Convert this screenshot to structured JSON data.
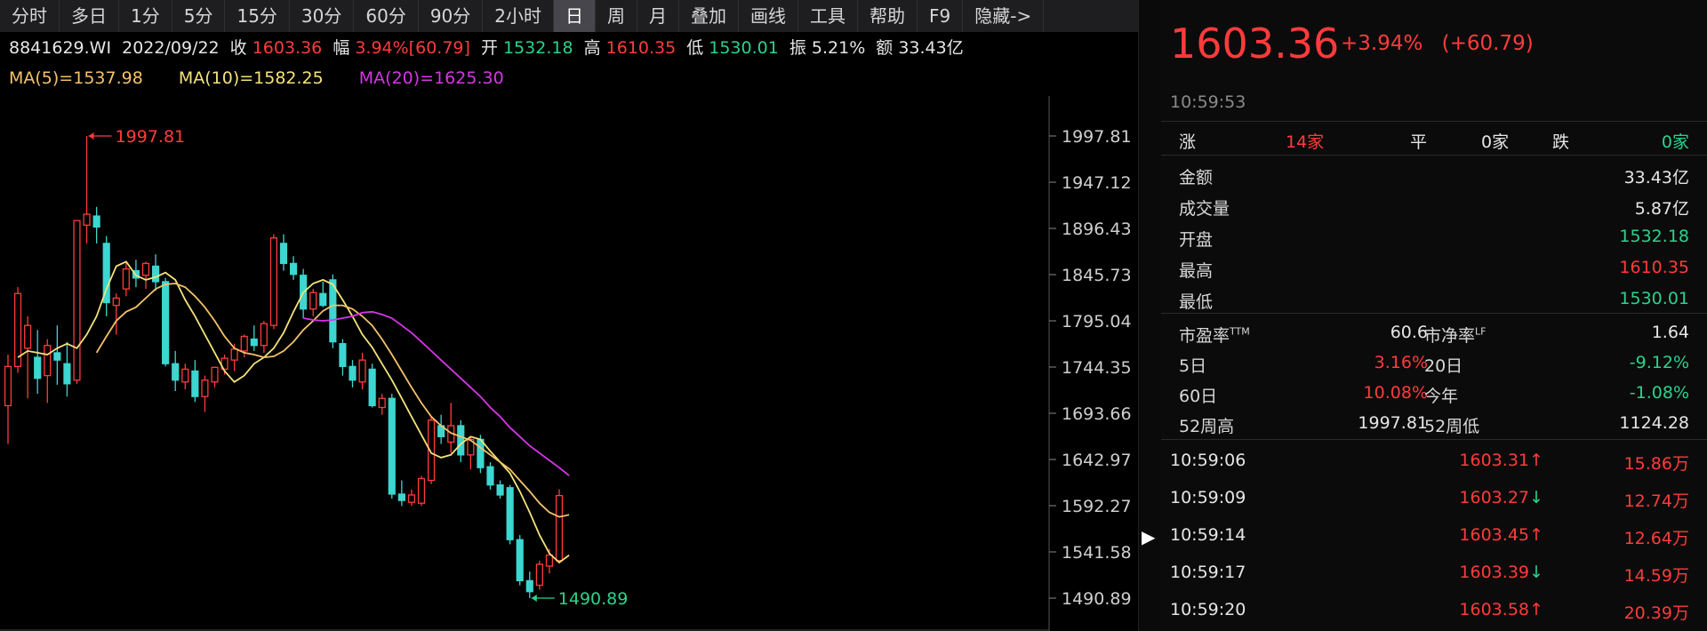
{
  "toolbar": {
    "tabs": [
      "分时",
      "多日",
      "1分",
      "5分",
      "15分",
      "30分",
      "60分",
      "90分",
      "2小时",
      "日",
      "周",
      "月",
      "叠加",
      "画线",
      "工具",
      "帮助",
      "F9",
      "隐藏->"
    ],
    "active": "日"
  },
  "info_line": {
    "code": "8841629.WI",
    "date": "2022/09/22",
    "close_label": "收",
    "close": "1603.36",
    "amp_label": "幅",
    "amp": "3.94%[60.79]",
    "open_label": "开",
    "open": "1532.18",
    "high_label": "高",
    "high": "1610.35",
    "low_label": "低",
    "low": "1530.01",
    "swing_label": "振",
    "swing": "5.21%",
    "amount_label": "额",
    "amount": "33.43亿"
  },
  "ma_line": {
    "ma5": "MA(5)=1537.98",
    "ma10": "MA(10)=1582.25",
    "ma20": "MA(20)=1625.30"
  },
  "colors": {
    "up": "#ff3b3b",
    "down": "#3dd6d0",
    "ma5": "#f3e37a",
    "ma10": "#f3c26b",
    "ma20": "#d636e6",
    "axis": "#cfcfcf"
  },
  "chart_data": {
    "type": "candlestick",
    "y_ticks": [
      "1997.81",
      "1947.12",
      "1896.43",
      "1845.73",
      "1795.04",
      "1744.35",
      "1693.66",
      "1642.97",
      "1592.27",
      "1541.58",
      "1490.89"
    ],
    "ylim": [
      1490.89,
      1997.81
    ],
    "annotations": [
      {
        "text": "1997.81",
        "value": 1997.81,
        "type": "high"
      },
      {
        "text": "1490.89",
        "value": 1490.89,
        "type": "low"
      }
    ],
    "candles": [
      {
        "o": 1702,
        "h": 1758,
        "l": 1660,
        "c": 1745
      },
      {
        "o": 1745,
        "h": 1832,
        "l": 1738,
        "c": 1825
      },
      {
        "o": 1765,
        "h": 1800,
        "l": 1710,
        "c": 1790
      },
      {
        "o": 1755,
        "h": 1785,
        "l": 1715,
        "c": 1732
      },
      {
        "o": 1735,
        "h": 1775,
        "l": 1705,
        "c": 1768
      },
      {
        "o": 1760,
        "h": 1790,
        "l": 1725,
        "c": 1752
      },
      {
        "o": 1748,
        "h": 1772,
        "l": 1712,
        "c": 1726
      },
      {
        "o": 1730,
        "h": 1900,
        "l": 1726,
        "c": 1905
      },
      {
        "o": 1900,
        "h": 1997.81,
        "l": 1880,
        "c": 1912
      },
      {
        "o": 1910,
        "h": 1920,
        "l": 1880,
        "c": 1898
      },
      {
        "o": 1880,
        "h": 1888,
        "l": 1800,
        "c": 1815
      },
      {
        "o": 1812,
        "h": 1825,
        "l": 1780,
        "c": 1820
      },
      {
        "o": 1830,
        "h": 1860,
        "l": 1822,
        "c": 1852
      },
      {
        "o": 1850,
        "h": 1862,
        "l": 1832,
        "c": 1842
      },
      {
        "o": 1845,
        "h": 1860,
        "l": 1830,
        "c": 1858
      },
      {
        "o": 1855,
        "h": 1868,
        "l": 1828,
        "c": 1838
      },
      {
        "o": 1838,
        "h": 1842,
        "l": 1745,
        "c": 1748
      },
      {
        "o": 1748,
        "h": 1762,
        "l": 1718,
        "c": 1730
      },
      {
        "o": 1728,
        "h": 1748,
        "l": 1720,
        "c": 1742
      },
      {
        "o": 1740,
        "h": 1752,
        "l": 1706,
        "c": 1712
      },
      {
        "o": 1712,
        "h": 1735,
        "l": 1695,
        "c": 1730
      },
      {
        "o": 1728,
        "h": 1745,
        "l": 1722,
        "c": 1744
      },
      {
        "o": 1742,
        "h": 1758,
        "l": 1736,
        "c": 1754
      },
      {
        "o": 1752,
        "h": 1770,
        "l": 1740,
        "c": 1764
      },
      {
        "o": 1762,
        "h": 1780,
        "l": 1755,
        "c": 1778
      },
      {
        "o": 1775,
        "h": 1790,
        "l": 1762,
        "c": 1768
      },
      {
        "o": 1768,
        "h": 1795,
        "l": 1760,
        "c": 1792
      },
      {
        "o": 1790,
        "h": 1890,
        "l": 1786,
        "c": 1886
      },
      {
        "o": 1880,
        "h": 1890,
        "l": 1850,
        "c": 1858
      },
      {
        "o": 1858,
        "h": 1866,
        "l": 1840,
        "c": 1846
      },
      {
        "o": 1845,
        "h": 1852,
        "l": 1798,
        "c": 1808
      },
      {
        "o": 1808,
        "h": 1830,
        "l": 1800,
        "c": 1826
      },
      {
        "o": 1825,
        "h": 1838,
        "l": 1810,
        "c": 1812
      },
      {
        "o": 1840,
        "h": 1846,
        "l": 1765,
        "c": 1772
      },
      {
        "o": 1770,
        "h": 1775,
        "l": 1735,
        "c": 1745
      },
      {
        "o": 1745,
        "h": 1752,
        "l": 1722,
        "c": 1730
      },
      {
        "o": 1728,
        "h": 1760,
        "l": 1720,
        "c": 1752
      },
      {
        "o": 1742,
        "h": 1748,
        "l": 1700,
        "c": 1702
      },
      {
        "o": 1700,
        "h": 1715,
        "l": 1692,
        "c": 1710
      },
      {
        "o": 1710,
        "h": 1715,
        "l": 1600,
        "c": 1605
      },
      {
        "o": 1605,
        "h": 1620,
        "l": 1592,
        "c": 1598
      },
      {
        "o": 1596,
        "h": 1610,
        "l": 1592,
        "c": 1604
      },
      {
        "o": 1595,
        "h": 1625,
        "l": 1592,
        "c": 1622
      },
      {
        "o": 1620,
        "h": 1690,
        "l": 1616,
        "c": 1686
      },
      {
        "o": 1680,
        "h": 1692,
        "l": 1660,
        "c": 1668
      },
      {
        "o": 1662,
        "h": 1705,
        "l": 1650,
        "c": 1680
      },
      {
        "o": 1680,
        "h": 1686,
        "l": 1640,
        "c": 1648
      },
      {
        "o": 1648,
        "h": 1668,
        "l": 1632,
        "c": 1665
      },
      {
        "o": 1665,
        "h": 1670,
        "l": 1628,
        "c": 1634
      },
      {
        "o": 1635,
        "h": 1640,
        "l": 1610,
        "c": 1615
      },
      {
        "o": 1615,
        "h": 1620,
        "l": 1600,
        "c": 1604
      },
      {
        "o": 1612,
        "h": 1615,
        "l": 1550,
        "c": 1555
      },
      {
        "o": 1555,
        "h": 1560,
        "l": 1505,
        "c": 1510
      },
      {
        "o": 1510,
        "h": 1520,
        "l": 1490.89,
        "c": 1498
      },
      {
        "o": 1505,
        "h": 1532,
        "l": 1500,
        "c": 1528
      },
      {
        "o": 1526,
        "h": 1545,
        "l": 1518,
        "c": 1538
      },
      {
        "o": 1532.18,
        "h": 1610.35,
        "l": 1530.01,
        "c": 1603.36
      }
    ],
    "ma5_values": [
      1755,
      1762,
      1760,
      1758,
      1765,
      1770,
      1765,
      1780,
      1800,
      1830,
      1855,
      1860,
      1845,
      1840,
      1843,
      1848,
      1840,
      1818,
      1800,
      1780,
      1760,
      1740,
      1728,
      1735,
      1748,
      1755,
      1765,
      1782,
      1805,
      1826,
      1836,
      1840,
      1835,
      1818,
      1800,
      1780,
      1766,
      1748,
      1730,
      1710,
      1690,
      1670,
      1650,
      1645,
      1648,
      1660,
      1668,
      1665,
      1652,
      1640,
      1628,
      1608,
      1585,
      1560,
      1540,
      1530,
      1537.98
    ],
    "ma10_values": [
      null,
      null,
      null,
      null,
      null,
      null,
      null,
      null,
      1760,
      1778,
      1795,
      1805,
      1810,
      1820,
      1830,
      1835,
      1836,
      1832,
      1822,
      1810,
      1795,
      1778,
      1765,
      1760,
      1758,
      1755,
      1756,
      1762,
      1772,
      1785,
      1795,
      1806,
      1812,
      1812,
      1808,
      1800,
      1790,
      1775,
      1758,
      1740,
      1722,
      1705,
      1690,
      1680,
      1672,
      1668,
      1664,
      1656,
      1648,
      1640,
      1632,
      1620,
      1608,
      1595,
      1585,
      1580,
      1582.25
    ],
    "ma20_values": [
      null,
      null,
      null,
      null,
      null,
      null,
      null,
      null,
      null,
      null,
      null,
      null,
      null,
      null,
      null,
      null,
      null,
      null,
      null,
      null,
      null,
      null,
      1798,
      1796,
      1795,
      1796,
      1798,
      1800,
      1804,
      1805,
      1802,
      1798,
      1790,
      1782,
      1772,
      1762,
      1752,
      1742,
      1732,
      1722,
      1712,
      1700,
      1690,
      1678,
      1668,
      1658,
      1650,
      1642,
      1634,
      1625.3
    ]
  },
  "right_panel": {
    "price": "1603.36",
    "change_pct": "+3.94%",
    "change_val": "(+60.79)",
    "time": "10:59:53",
    "breadth": {
      "up_label": "涨",
      "up_count": "14家",
      "flat_label": "平",
      "flat_count": "0家",
      "down_label": "跌",
      "down_count": "0家"
    },
    "stats": [
      {
        "k": "金额",
        "v": "33.43亿",
        "color": "white"
      },
      {
        "k": "成交量",
        "v": "5.87亿",
        "color": "white"
      },
      {
        "k": "开盘",
        "v": "1532.18",
        "color": "green"
      },
      {
        "k": "最高",
        "v": "1610.35",
        "color": "red"
      },
      {
        "k": "最低",
        "v": "1530.01",
        "color": "green"
      }
    ],
    "ratios": {
      "pe_label": "市盈率",
      "pe_sup": "TTM",
      "pe": "60.6",
      "pb_label": "市净率",
      "pb_sup": "LF",
      "pb": "1.64",
      "r5_label": "5日",
      "r5": "3.16%",
      "r20_label": "20日",
      "r20": "-9.12%",
      "r60_label": "60日",
      "r60": "10.08%",
      "ytd_label": "今年",
      "ytd": "-1.08%",
      "h52_label": "52周高",
      "h52": "1997.81",
      "l52_label": "52周低",
      "l52": "1124.28"
    },
    "ticks": [
      {
        "time": "10:59:06",
        "price": "1603.31",
        "dir": "up",
        "vol": "15.86万"
      },
      {
        "time": "10:59:09",
        "price": "1603.27",
        "dir": "down",
        "vol": "12.74万"
      },
      {
        "time": "10:59:14",
        "price": "1603.45",
        "dir": "up",
        "vol": "12.64万"
      },
      {
        "time": "10:59:17",
        "price": "1603.39",
        "dir": "down",
        "vol": "14.59万"
      },
      {
        "time": "10:59:20",
        "price": "1603.58",
        "dir": "up",
        "vol": "20.39万"
      }
    ]
  }
}
